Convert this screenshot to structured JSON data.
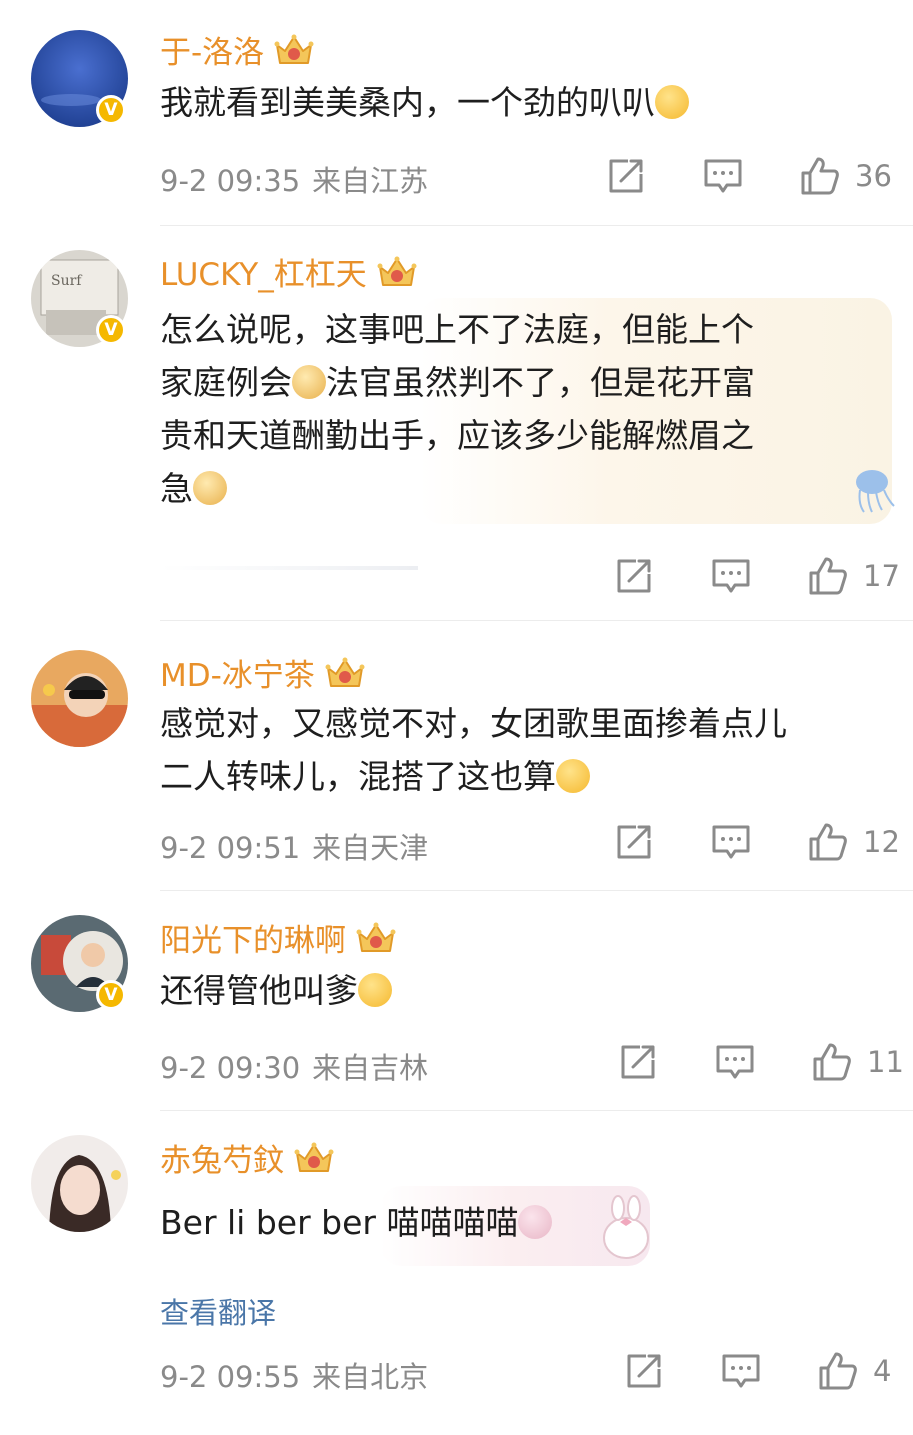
{
  "comments": [
    {
      "username": "于-洛洛",
      "content": [
        "我就看到美美桑内，一个劲的叭叭"
      ],
      "time": "9-2 09:35",
      "location": "来自江苏",
      "likes": "36",
      "verified": true
    },
    {
      "username": "LUCKY_杠杠天",
      "content": [
        "怎么说呢，这事吧上不了法庭，但能上个",
        "家庭例会",
        "法官虽然判不了，但是花开富",
        "贵和天道酬勤出手，应该多少能解燃眉之",
        "急"
      ],
      "time": "",
      "location": "",
      "likes": "17",
      "verified": true
    },
    {
      "username": "MD-冰宁茶",
      "content": [
        "感觉对，又感觉不对，女团歌里面掺着点儿",
        "二人转味儿，混搭了这也算"
      ],
      "time": "9-2 09:51",
      "location": "来自天津",
      "likes": "12",
      "verified": false
    },
    {
      "username": "阳光下的琳啊",
      "content": [
        "还得管他叫爹"
      ],
      "time": "9-2 09:30",
      "location": "来自吉林",
      "likes": "11",
      "verified": true
    },
    {
      "username": "赤兔芍鈫",
      "content": [
        "Ber li ber ber 喵喵喵喵"
      ],
      "time": "9-2 09:55",
      "location": "来自北京",
      "likes": "4",
      "verified": false,
      "translate_link": "查看翻译"
    }
  ],
  "icons": {
    "repost": "repost-icon",
    "comment": "comment-icon",
    "like": "like-icon",
    "crown": "crown-badge-icon",
    "verified": "verified-v-icon"
  },
  "colors": {
    "username": "#e8902a",
    "meta": "#8a8a8a",
    "link": "#4a76a8",
    "verified_badge": "#f5b800"
  }
}
